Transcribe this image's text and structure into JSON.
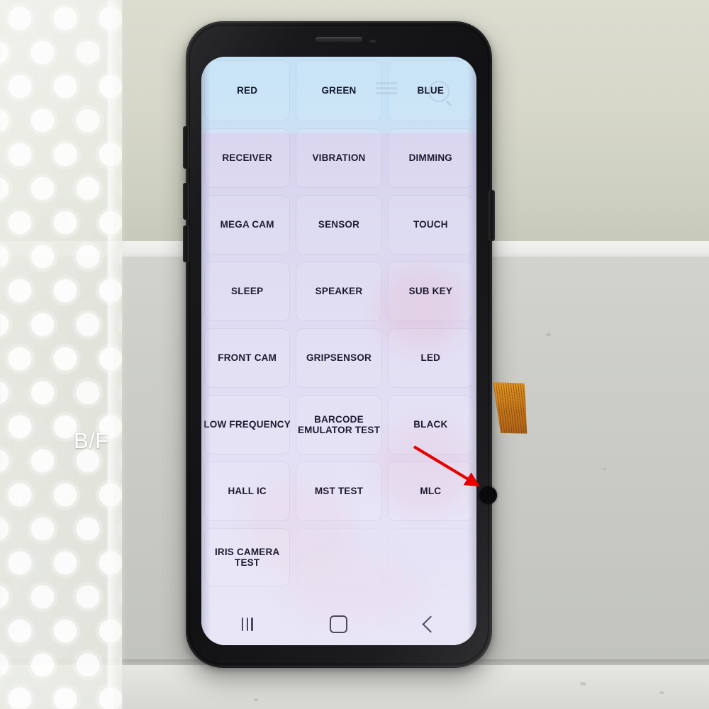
{
  "scene": {
    "description_label": "B/F",
    "background": {
      "wall_color": "#d7d8ca",
      "shelf_color": "#c8c9c3",
      "floor_color": "#e0e0dc",
      "bubble_wrap_color": "#ecefe7"
    },
    "flex_cable_color": "#c7761a"
  },
  "annotation": {
    "arrow_color": "#e60000",
    "defect_dot_color": "#0a0a0c",
    "arrow_name": "defect-pointer-arrow"
  },
  "phone": {
    "body_color": "#161618",
    "icons": {
      "earpiece": "earpiece-speaker",
      "front_sensor": "front-sensor",
      "bixby": "bixby-button",
      "volume_up": "volume-up-button",
      "volume_down": "volume-down-button",
      "power": "power-button"
    }
  },
  "screen": {
    "blue_band_color": "#c6e2f6",
    "body_color": "#e2def4",
    "text_color": "#1d1b31",
    "ghost_icons": {
      "search": "search-icon-ghost",
      "bars": "menu-bars-ghost"
    },
    "grid": {
      "columns": 3,
      "rows": [
        [
          "RED",
          "GREEN",
          "BLUE"
        ],
        [
          "RECEIVER",
          "VIBRATION",
          "DIMMING"
        ],
        [
          "MEGA CAM",
          "SENSOR",
          "TOUCH"
        ],
        [
          "SLEEP",
          "SPEAKER",
          "SUB KEY"
        ],
        [
          "FRONT CAM",
          "GRIPSENSOR",
          "LED"
        ],
        [
          "LOW FREQUENCY",
          "BARCODE EMULATOR TEST",
          "BLACK"
        ],
        [
          "HALL IC",
          "MST TEST",
          "MLC"
        ],
        [
          "IRIS CAMERA TEST",
          "",
          ""
        ]
      ]
    },
    "navbar": {
      "recents_label": "recents-icon",
      "home_label": "home-icon",
      "back_label": "back-icon"
    }
  }
}
